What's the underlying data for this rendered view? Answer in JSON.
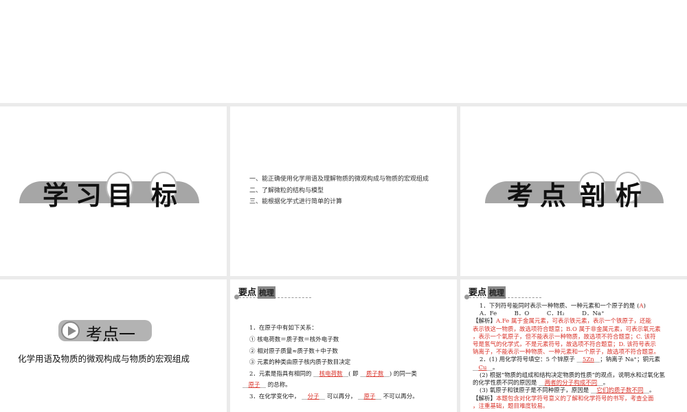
{
  "slide_top": {},
  "slide_goals": {
    "title_chars": [
      "学",
      "习",
      "目",
      "标"
    ]
  },
  "slide_objectives": {
    "items": [
      "一、能正确使用化学用语及理解物质的微观构成与物质的宏观组成",
      "二、了解微粒的结构与模型",
      "三、能根据化学式进行简单的计算"
    ]
  },
  "slide_kaodian": {
    "title_chars": [
      "考",
      "点",
      "剖",
      "析"
    ]
  },
  "slide_point1": {
    "badge": "考点一",
    "subtitle": "化学用语及物质的微观构成与物质的宏观组成"
  },
  "slide_review": {
    "header": "要点",
    "header_tag": "梳理",
    "l1": "1．在原子中有如下关系：",
    "l2": "① 核电荷数＝质子数＝核外电子数",
    "l3": "② 相对原子质量≈质子数＋中子数",
    "l4": "③ 元素的种类由原子核内质子数目决定",
    "l5a": "2．元素是指具有相同的 __",
    "l5b": "核电荷数",
    "l5c": "__( 即 __",
    "l5d": "质子数",
    "l5e": "__) 的同一类",
    "l6a": "__",
    "l6b": "原子",
    "l6c": "__ 的总称。",
    "l7a": "3．在化学变化中， __",
    "l7b": "分子",
    "l7c": "__ 可以再分， __",
    "l7d": "原子",
    "l7e": "__ 不可以再分。"
  },
  "slide_exercise": {
    "header": "要点",
    "header_tag": "梳理",
    "q1": "1．下列符号能同时表示一种物质、一种元素和一个原子的是 (",
    "q1ans": "A",
    "q1end": ")",
    "opts": "A．Fe　　　B．O　　　C．H₂　　　D．Na⁺",
    "a1": "【解析】",
    "a1t": "A.Fe 属于金属元素，可表示铁元素，表示一个铁原子，还能",
    "a2": "表示铁这一物质，故选项符合题意；B.O 属于非金属元素，可表示氧元素",
    "a3": "，表示一个氧原子，但不能表示一种物质，故选项不符合题意；C. 该符",
    "a4": "号是氢气的化学式，不是元素符号，故选项不符合题意；D. 该符号表示",
    "a5": "钠离子，不能表示一种物质、一种元素和一个原子，故选项不符合题意。",
    "q2a": "2．(1) 用化学符号填空：5 个锌原子 __",
    "q2b": "5Zn",
    "q2c": "__；钠离子 Na⁺；铜元素",
    "q2d": "__",
    "q2e": "Cu",
    "q2f": "__。",
    "q3a": "(2) 根据“物质的组成和结构决定物质的性质”的观点，说明水和过氧化氢",
    "q3b": "的化学性质不同的原因是 __",
    "q3c": "两者的分子构成不同",
    "q3d": "__。",
    "q4a": "(3) 氧原子和镁原子是不同种原子，原因是 __",
    "q4b": "它们的质子数不同",
    "q4c": "__。",
    "a6": "【解析】",
    "a6t": "本题包含对化学符号意义的了解和化学符号的书写，考查全面",
    "a7": "，注重基础，题目难度较易。"
  }
}
